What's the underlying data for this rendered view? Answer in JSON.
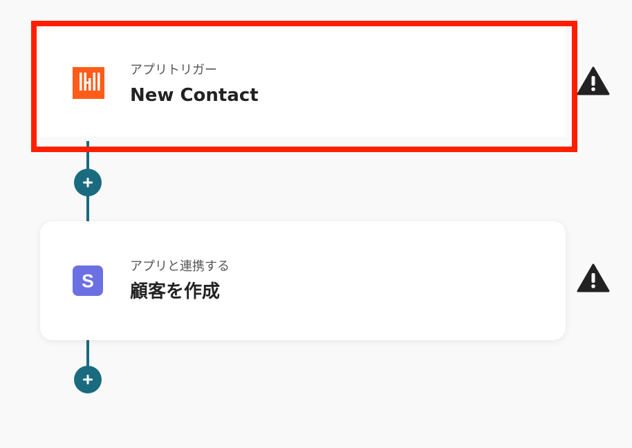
{
  "flow": {
    "steps": [
      {
        "subtitle": "アプリトリガー",
        "title": "New Contact",
        "app_icon": "hubspot-style-orange-logo-icon",
        "brand_color": "#ff5c1a",
        "selected": true,
        "warning_icon": "warning-triangle-icon"
      },
      {
        "subtitle": "アプリと連携する",
        "title": "顧客を作成",
        "app_icon": "stripe-s-logo-icon",
        "brand_color": "#6b71e3",
        "selected": false,
        "warning_icon": "warning-triangle-icon"
      }
    ],
    "add_step_icon": "plus-icon",
    "connector_color": "#1b6b80",
    "highlight_color": "#ff1f00"
  }
}
